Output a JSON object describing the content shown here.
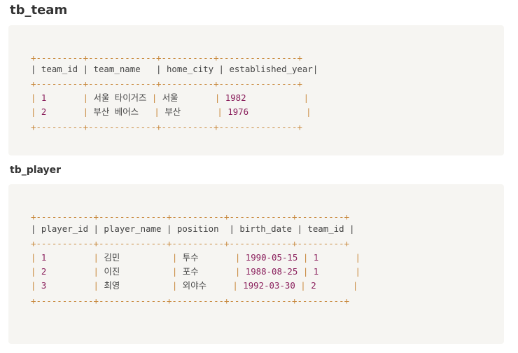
{
  "team": {
    "title": "tb_team",
    "border": "+---------+-------------+----------+---------------+",
    "header": "| team_id | team_name   | home_city | established_year|",
    "rows": [
      {
        "id": "1",
        "name": "서울 타이거즈",
        "city": "서울",
        "year": "1982"
      },
      {
        "id": "2",
        "name": "부산 베어스",
        "city": "부산",
        "year": "1976"
      }
    ]
  },
  "player": {
    "title": "tb_player",
    "border": "+-----------+-------------+----------+------------+---------+",
    "header": "| player_id | player_name | position  | birth_date | team_id |",
    "rows": [
      {
        "id": "1",
        "name": "김민",
        "pos": "투수",
        "birth": "1990-05-15",
        "team": "1"
      },
      {
        "id": "2",
        "name": "이진",
        "pos": "포수",
        "birth": "1988-08-25",
        "team": "1"
      },
      {
        "id": "3",
        "name": "최영",
        "pos": "외야수",
        "birth": "1992-03-30",
        "team": "2"
      }
    ]
  },
  "colors": {
    "background": "#f6f5f2",
    "border_chars": "#c98a3f",
    "numbers": "#8a1f5c"
  }
}
